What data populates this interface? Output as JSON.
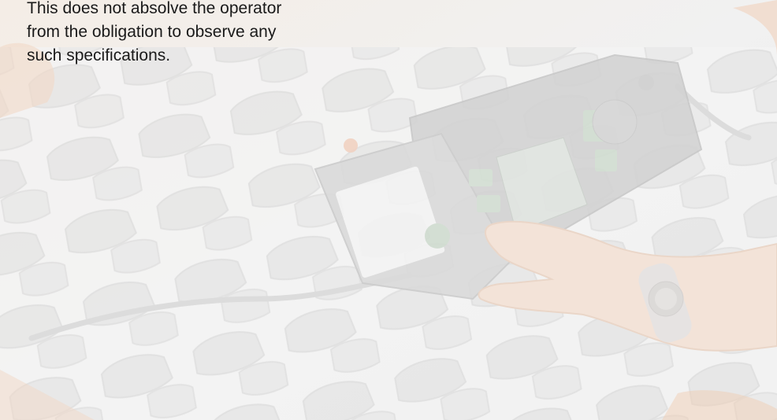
{
  "caption": {
    "lines": [
      "This does not absolve the operator",
      "from the obligation to observe any",
      "such specifications."
    ]
  },
  "background_photo": {
    "subject": "handheld-tester-on-massage-mat",
    "tint": "#f2f2f2",
    "accent_color": "#e9b48d"
  }
}
